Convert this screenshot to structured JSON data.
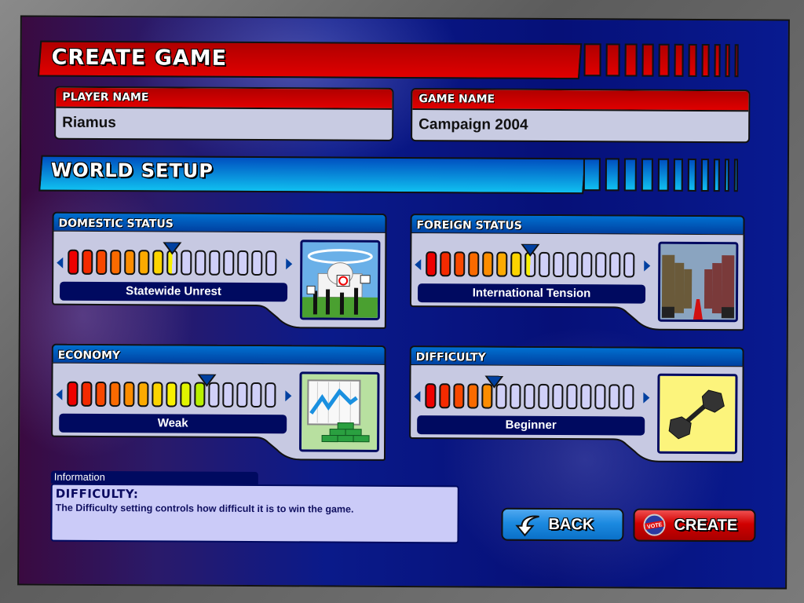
{
  "header": {
    "title": "CREATE GAME"
  },
  "player_name": {
    "label": "PLAYER NAME",
    "value": "Riamus"
  },
  "game_name": {
    "label": "GAME NAME",
    "value": "Campaign 2004"
  },
  "world_setup": {
    "title": "WORLD SETUP"
  },
  "segment_colors": [
    "#ee0000",
    "#f42a00",
    "#f84800",
    "#fa6a00",
    "#fc8c00",
    "#fcaa00",
    "#fcd400",
    "#f8f000",
    "#e0f400",
    "#b8f000"
  ],
  "empty_segment_color": "#d0d0f8",
  "sliders": {
    "domestic": {
      "label": "DOMESTIC STATUS",
      "value_text": "Statewide Unrest",
      "segments_total": 15,
      "level": 7.5,
      "image": "capitol-protest-image"
    },
    "foreign": {
      "label": "FOREIGN STATUS",
      "value_text": "International Tension",
      "segments_total": 15,
      "level": 7.5,
      "image": "soldiers-lineup-image"
    },
    "economy": {
      "label": "ECONOMY",
      "value_text": "Weak",
      "segments_total": 15,
      "level": 10,
      "image": "stock-chart-money-image"
    },
    "difficulty": {
      "label": "DIFFICULTY",
      "value_text": "Beginner",
      "segments_total": 15,
      "level": 5,
      "image": "dumbbell-image"
    }
  },
  "information": {
    "header": "Information",
    "title": "DIFFICULTY:",
    "text": "The Difficulty setting controls how difficult it is to win the game."
  },
  "buttons": {
    "back": {
      "label": "BACK",
      "icon": "back-arrow-icon"
    },
    "create": {
      "label": "CREATE",
      "icon": "vote-badge-icon"
    }
  }
}
